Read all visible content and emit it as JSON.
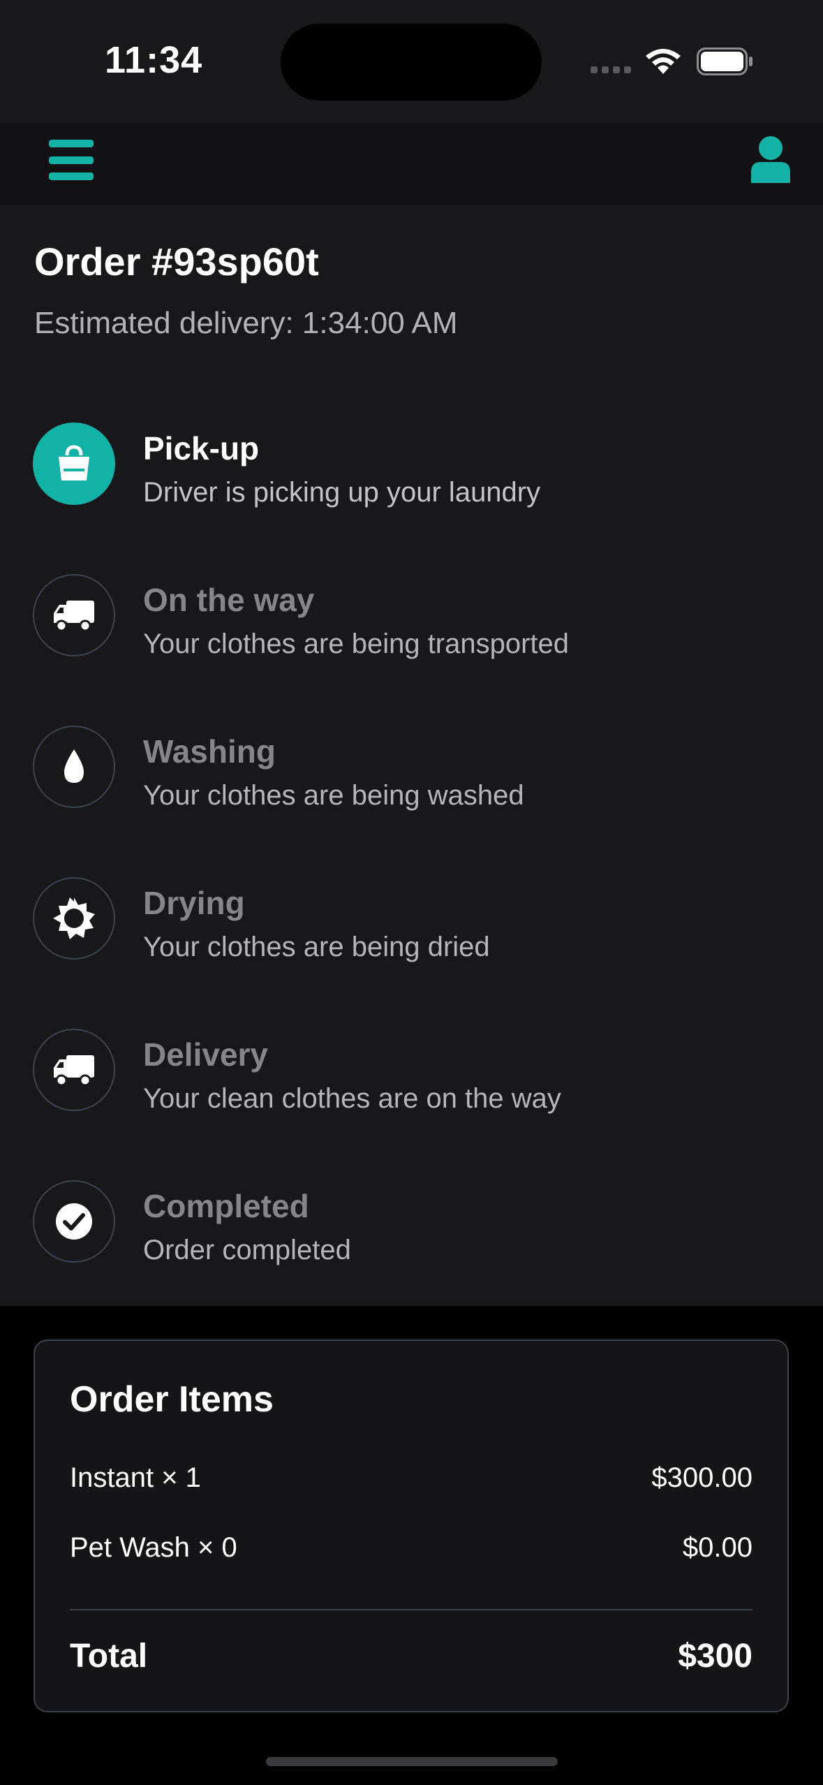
{
  "status_bar": {
    "time": "11:34"
  },
  "header": {
    "menu_icon": "hamburger-menu-icon",
    "profile_icon": "user-icon",
    "accent_color": "#14b1a7"
  },
  "order": {
    "title": "Order #93sp60t",
    "estimated_delivery": "Estimated delivery: 1:34:00 AM"
  },
  "steps": [
    {
      "title": "Pick-up",
      "description": "Driver is picking up your laundry",
      "icon": "shopping-bag-icon",
      "active": true
    },
    {
      "title": "On the way",
      "description": "Your clothes are being transported",
      "icon": "truck-icon",
      "active": false
    },
    {
      "title": "Washing",
      "description": "Your clothes are being washed",
      "icon": "water-drop-icon",
      "active": false
    },
    {
      "title": "Drying",
      "description": "Your clothes are being dried",
      "icon": "sun-icon",
      "active": false
    },
    {
      "title": "Delivery",
      "description": "Your clean clothes are on the way",
      "icon": "truck-icon",
      "active": false
    },
    {
      "title": "Completed",
      "description": "Order completed",
      "icon": "check-circle-icon",
      "active": false
    }
  ],
  "order_items": {
    "title": "Order Items",
    "items": [
      {
        "name": "Instant × 1",
        "price": "$300.00"
      },
      {
        "name": "Pet Wash × 0",
        "price": "$0.00"
      }
    ],
    "total_label": "Total",
    "total_amount": "$300"
  }
}
